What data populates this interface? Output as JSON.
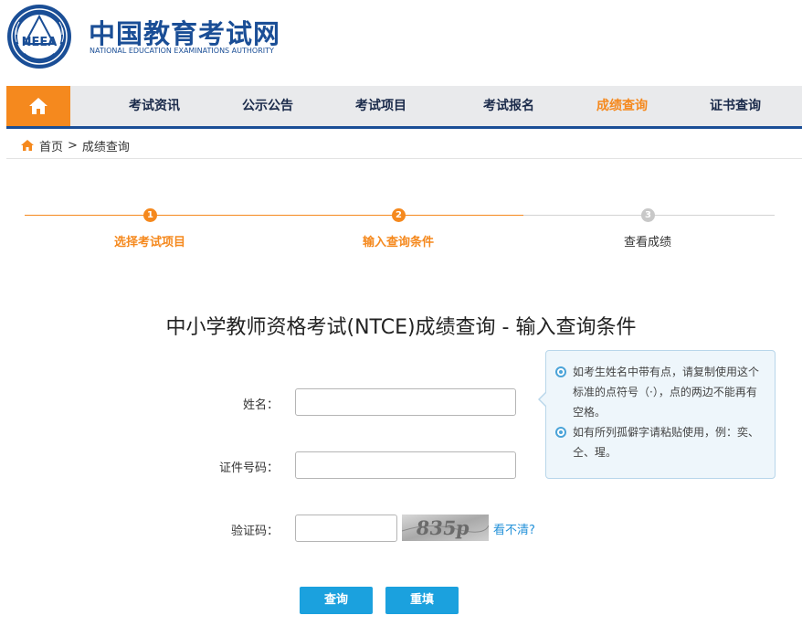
{
  "header": {
    "logo_cn": "中国教育考试网",
    "logo_en": "NATIONAL EDUCATION EXAMINATIONS AUTHORITY",
    "emblem_text": "NEEA"
  },
  "nav": {
    "home_icon": "home-icon",
    "items": [
      {
        "label": "考试资讯",
        "active": false
      },
      {
        "label": "公示公告",
        "active": false
      },
      {
        "label": "考试项目",
        "active": false
      },
      {
        "label": "考试报名",
        "active": false
      },
      {
        "label": "成绩查询",
        "active": true
      },
      {
        "label": "证书查询",
        "active": false
      }
    ]
  },
  "breadcrumb": {
    "home": "首页",
    "separator": ">",
    "current": "成绩查询"
  },
  "steps": [
    {
      "number": "1",
      "label": "选择考试项目",
      "state": "done"
    },
    {
      "number": "2",
      "label": "输入查询条件",
      "state": "done"
    },
    {
      "number": "3",
      "label": "查看成绩",
      "state": "todo"
    }
  ],
  "form": {
    "title": "中小学教师资格考试(NTCE)成绩查询 - 输入查询条件",
    "name_label": "姓名：",
    "name_value": "",
    "id_label": "证件号码：",
    "id_value": "",
    "captcha_label": "验证码：",
    "captcha_value": "",
    "captcha_text": "835p",
    "captcha_refresh": "看不清?",
    "submit_label": "查询",
    "reset_label": "重填"
  },
  "tip": {
    "items": [
      "如考生姓名中带有点，请复制使用这个标准的点符号（·），点的两边不能再有空格。",
      "如有所列孤僻字请粘贴使用，例：奕、仝、瑆。"
    ]
  },
  "colors": {
    "brand_blue": "#1a4e96",
    "accent_orange": "#f5891e",
    "button_blue": "#1ba1de",
    "link_blue": "#2592d9"
  }
}
